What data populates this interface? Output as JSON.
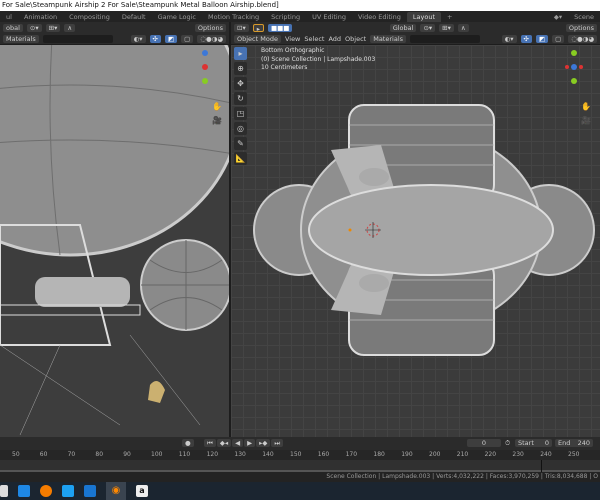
{
  "window": {
    "title": "For Sale\\Steampunk Airship 2 For Sale\\Steampunk Metal Balloon Airship.blend]"
  },
  "workspace_tabs": [
    "ul",
    "Animation",
    "Compositing",
    "Default",
    "Game Logic",
    "Motion Tracking",
    "Scripting",
    "UV Editing",
    "Video Editing",
    "Layout"
  ],
  "active_tab": "Layout",
  "scene_label": "Scene",
  "left_viewport": {
    "global": "obal",
    "options": "Options",
    "materials": "Materials"
  },
  "right_viewport": {
    "mode": "Object Mode",
    "menu": [
      "View",
      "Select",
      "Add",
      "Object"
    ],
    "orientation": "Global",
    "materials": "Materials",
    "options": "Options",
    "overlay": {
      "view": "Bottom Orthographic",
      "collection": "(0) Scene Collection | Lampshade.003",
      "scale": "10 Centimeters"
    }
  },
  "timeline": {
    "current_frame": "0",
    "start_label": "Start",
    "start": "0",
    "end_label": "End",
    "end": "240",
    "ticks": [
      "50",
      "60",
      "70",
      "80",
      "90",
      "100",
      "110",
      "120",
      "130",
      "140",
      "150",
      "160",
      "170",
      "180",
      "190",
      "200",
      "210",
      "220",
      "230",
      "240",
      "250"
    ]
  },
  "status": "Scene Collection | Lampshade.003 | Verts:4,032,222 | Faces:3,970,259 | Tris:8,034,688 | O",
  "colors": {
    "accent": "#4772b3",
    "viewport": "#3d3d3d",
    "header": "#2b2b2b"
  }
}
